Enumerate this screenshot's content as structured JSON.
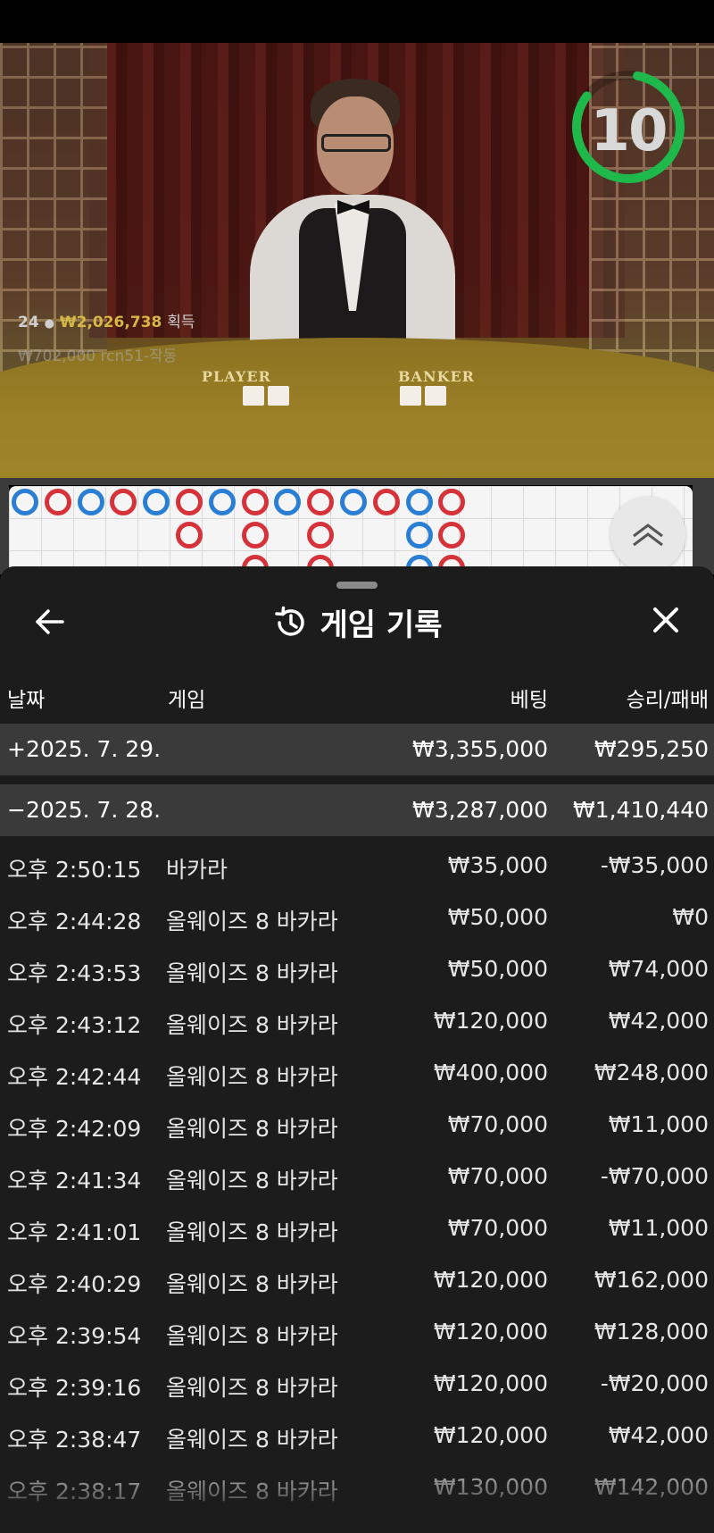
{
  "video": {
    "timer": "10",
    "winners_count": "24",
    "winners_amount": "₩2,026,738",
    "winners_label": "획득",
    "ticker": "₩702,000  rcn51-작동",
    "player_label": "PLAYER",
    "banker_label": "BANKER"
  },
  "roadmap": {
    "top_row": [
      "p",
      "b",
      "p",
      "b",
      "p",
      "b",
      "p",
      "b",
      "p",
      "b",
      "p",
      "b",
      "p",
      "b"
    ],
    "second_row": [
      "",
      "",
      "",
      "",
      "",
      "b",
      "",
      "b",
      "",
      "b",
      "",
      "",
      "p",
      "b"
    ],
    "third_row": [
      "",
      "",
      "",
      "",
      "",
      "",
      "",
      "b",
      "",
      "b",
      "",
      "",
      "p",
      "b"
    ]
  },
  "sheet": {
    "title": "게임 기록",
    "columns": {
      "date": "날짜",
      "game": "게임",
      "bet": "베팅",
      "winloss": "승리/패배"
    },
    "groups": [
      {
        "date": "+2025. 7. 29.",
        "bet": "₩3,355,000",
        "winloss": "₩295,250"
      },
      {
        "date": "−2025. 7. 28.",
        "bet": "₩3,287,000",
        "winloss": "₩1,410,440"
      }
    ],
    "rows": [
      {
        "time": "오후 2:50:15",
        "game": "바카라",
        "bet": "₩35,000",
        "winloss": "-₩35,000"
      },
      {
        "time": "오후 2:44:28",
        "game": "올웨이즈 8 바카라",
        "bet": "₩50,000",
        "winloss": "₩0"
      },
      {
        "time": "오후 2:43:53",
        "game": "올웨이즈 8 바카라",
        "bet": "₩50,000",
        "winloss": "₩74,000"
      },
      {
        "time": "오후 2:43:12",
        "game": "올웨이즈 8 바카라",
        "bet": "₩120,000",
        "winloss": "₩42,000"
      },
      {
        "time": "오후 2:42:44",
        "game": "올웨이즈 8 바카라",
        "bet": "₩400,000",
        "winloss": "₩248,000"
      },
      {
        "time": "오후 2:42:09",
        "game": "올웨이즈 8 바카라",
        "bet": "₩70,000",
        "winloss": "₩11,000"
      },
      {
        "time": "오후 2:41:34",
        "game": "올웨이즈 8 바카라",
        "bet": "₩70,000",
        "winloss": "-₩70,000"
      },
      {
        "time": "오후 2:41:01",
        "game": "올웨이즈 8 바카라",
        "bet": "₩70,000",
        "winloss": "₩11,000"
      },
      {
        "time": "오후 2:40:29",
        "game": "올웨이즈 8 바카라",
        "bet": "₩120,000",
        "winloss": "₩162,000"
      },
      {
        "time": "오후 2:39:54",
        "game": "올웨이즈 8 바카라",
        "bet": "₩120,000",
        "winloss": "₩128,000"
      },
      {
        "time": "오후 2:39:16",
        "game": "올웨이즈 8 바카라",
        "bet": "₩120,000",
        "winloss": "-₩20,000"
      },
      {
        "time": "오후 2:38:47",
        "game": "올웨이즈 8 바카라",
        "bet": "₩120,000",
        "winloss": "₩42,000"
      },
      {
        "time": "오후 2:38:17",
        "game": "올웨이즈 8 바카라",
        "bet": "₩130,000",
        "winloss": "₩142,000"
      }
    ]
  },
  "colors": {
    "player": "#2a7fd4",
    "banker": "#d6323a",
    "timer": "#1fb84a",
    "sheet_bg": "#1c1c1c",
    "group_bg": "#3a3a3a"
  },
  "icons": {
    "back": "arrow-left-icon",
    "history": "history-icon",
    "close": "close-icon",
    "scroll_up": "chevron-up-icon"
  }
}
